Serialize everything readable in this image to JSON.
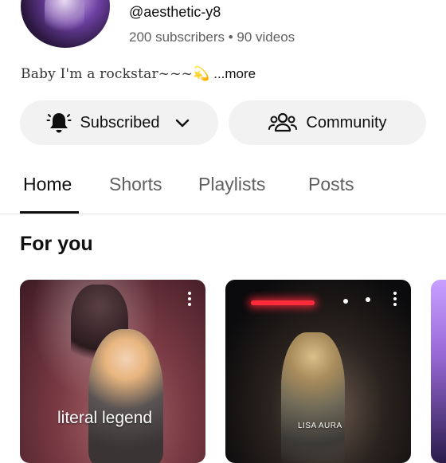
{
  "channel": {
    "handle": "@aesthetic-y8",
    "stats": "200 subscribers • 90 videos",
    "bio": "Baby I'm a rockstar~~~💫",
    "bio_more": "...more"
  },
  "actions": {
    "subscribed_label": "Subscribed",
    "community_label": "Community"
  },
  "tabs": [
    {
      "label": "Home",
      "active": true
    },
    {
      "label": "Shorts",
      "active": false
    },
    {
      "label": "Playlists",
      "active": false
    },
    {
      "label": "Posts",
      "active": false
    }
  ],
  "section": {
    "title": "For you"
  },
  "cards": [
    {
      "overlay_text": "literal legend"
    },
    {
      "overlay_text": "LISA AURA"
    },
    {
      "overlay_text": ""
    }
  ],
  "icons": {
    "bell": "bell-icon",
    "chevron": "chevron-down-icon",
    "community": "community-icon",
    "kebab": "more-vert-icon"
  },
  "colors": {
    "text_primary": "#0f0f0f",
    "text_secondary": "#606060",
    "pill_bg": "#f2f2f2",
    "divider": "#e5e5e5"
  }
}
